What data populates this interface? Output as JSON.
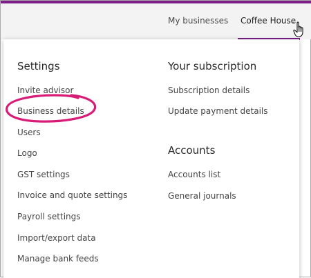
{
  "nav": {
    "my_businesses": "My businesses",
    "current_business": "Coffee House"
  },
  "settings": {
    "heading": "Settings",
    "items": [
      "Invite advisor",
      "Business details",
      "Users",
      "Logo",
      "GST settings",
      "Invoice and quote settings",
      "Payroll settings",
      "Import/export data",
      "Manage bank feeds"
    ]
  },
  "subscription": {
    "heading": "Your subscription",
    "items": [
      "Subscription details",
      "Update payment details"
    ]
  },
  "accounts": {
    "heading": "Accounts",
    "items": [
      "Accounts list",
      "General journals"
    ]
  },
  "colors": {
    "accent": "#7b1f86",
    "highlight_circle": "#d81b76"
  }
}
